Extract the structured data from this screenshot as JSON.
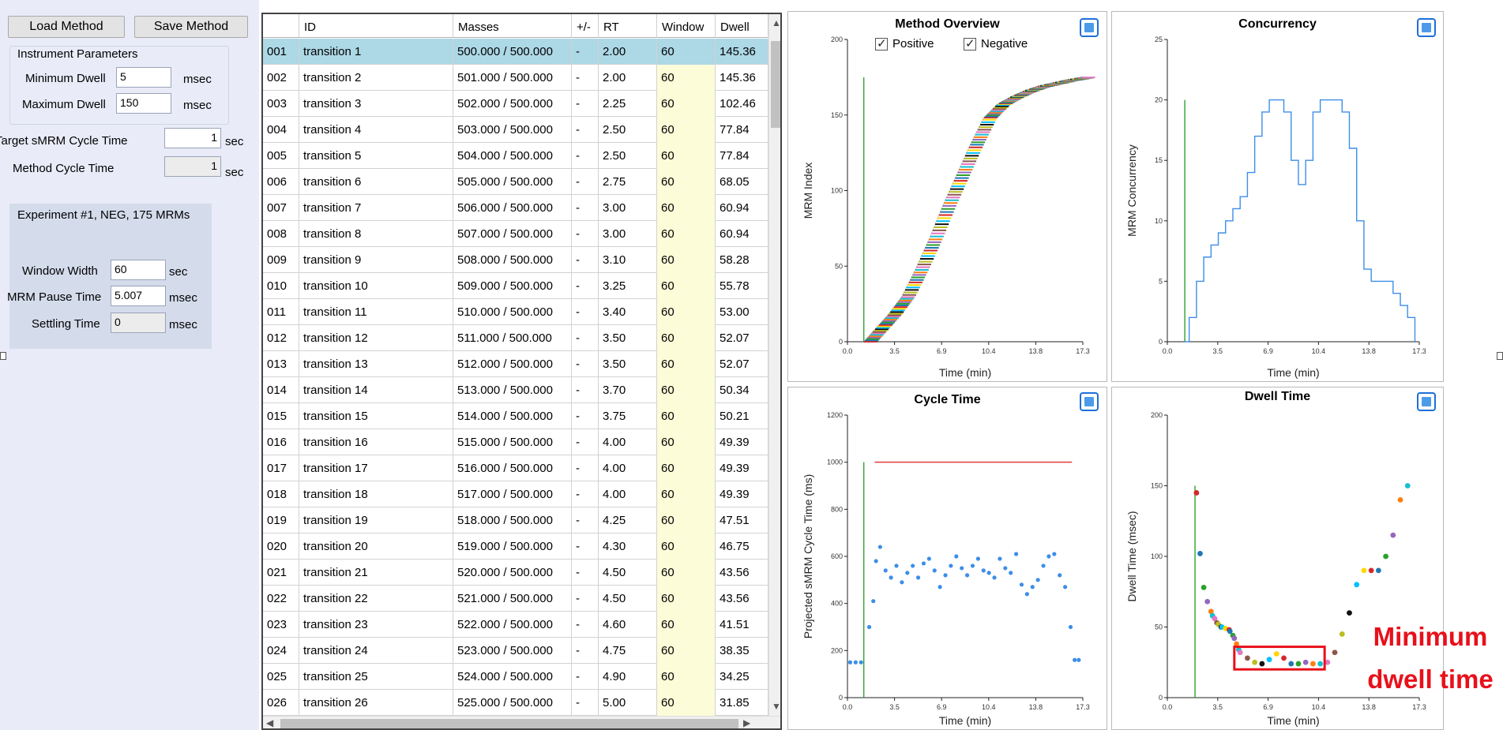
{
  "left_panel": {
    "load_button": "Load Method",
    "save_button": "Save Method",
    "instrument_params_title": "Instrument Parameters",
    "min_dwell_label": "Minimum Dwell",
    "min_dwell_value": "5",
    "min_dwell_unit": "msec",
    "max_dwell_label": "Maximum Dwell",
    "max_dwell_value": "150",
    "max_dwell_unit": "msec",
    "target_cycle_label": "Target sMRM Cycle Time",
    "target_cycle_value": "1",
    "target_cycle_unit": "sec",
    "method_cycle_label": "Method Cycle Time",
    "method_cycle_value": "1",
    "method_cycle_unit": "sec",
    "experiment_title": "Experiment #1, NEG, 175 MRMs",
    "window_width_label": "Window Width",
    "window_width_value": "60",
    "window_width_unit": "sec",
    "pause_label": "MRM Pause Time",
    "pause_value": "5.007",
    "pause_unit": "msec",
    "settling_label": "Settling Time",
    "settling_value": "0",
    "settling_unit": "msec"
  },
  "table": {
    "columns": [
      "ID",
      "Masses",
      "+/-",
      "RT",
      "Window",
      "Dwell"
    ],
    "rows": [
      {
        "num": "001",
        "id": "transition 1",
        "masses": "500.000 / 500.000",
        "pm": "-",
        "rt": "2.00",
        "window": "60",
        "dwell": "145.36"
      },
      {
        "num": "002",
        "id": "transition 2",
        "masses": "501.000 / 500.000",
        "pm": "-",
        "rt": "2.00",
        "window": "60",
        "dwell": "145.36"
      },
      {
        "num": "003",
        "id": "transition 3",
        "masses": "502.000 / 500.000",
        "pm": "-",
        "rt": "2.25",
        "window": "60",
        "dwell": "102.46"
      },
      {
        "num": "004",
        "id": "transition 4",
        "masses": "503.000 / 500.000",
        "pm": "-",
        "rt": "2.50",
        "window": "60",
        "dwell": "77.84"
      },
      {
        "num": "005",
        "id": "transition 5",
        "masses": "504.000 / 500.000",
        "pm": "-",
        "rt": "2.50",
        "window": "60",
        "dwell": "77.84"
      },
      {
        "num": "006",
        "id": "transition 6",
        "masses": "505.000 / 500.000",
        "pm": "-",
        "rt": "2.75",
        "window": "60",
        "dwell": "68.05"
      },
      {
        "num": "007",
        "id": "transition 7",
        "masses": "506.000 / 500.000",
        "pm": "-",
        "rt": "3.00",
        "window": "60",
        "dwell": "60.94"
      },
      {
        "num": "008",
        "id": "transition 8",
        "masses": "507.000 / 500.000",
        "pm": "-",
        "rt": "3.00",
        "window": "60",
        "dwell": "60.94"
      },
      {
        "num": "009",
        "id": "transition 9",
        "masses": "508.000 / 500.000",
        "pm": "-",
        "rt": "3.10",
        "window": "60",
        "dwell": "58.28"
      },
      {
        "num": "010",
        "id": "transition 10",
        "masses": "509.000 / 500.000",
        "pm": "-",
        "rt": "3.25",
        "window": "60",
        "dwell": "55.78"
      },
      {
        "num": "011",
        "id": "transition 11",
        "masses": "510.000 / 500.000",
        "pm": "-",
        "rt": "3.40",
        "window": "60",
        "dwell": "53.00"
      },
      {
        "num": "012",
        "id": "transition 12",
        "masses": "511.000 / 500.000",
        "pm": "-",
        "rt": "3.50",
        "window": "60",
        "dwell": "52.07"
      },
      {
        "num": "013",
        "id": "transition 13",
        "masses": "512.000 / 500.000",
        "pm": "-",
        "rt": "3.50",
        "window": "60",
        "dwell": "52.07"
      },
      {
        "num": "014",
        "id": "transition 14",
        "masses": "513.000 / 500.000",
        "pm": "-",
        "rt": "3.70",
        "window": "60",
        "dwell": "50.34"
      },
      {
        "num": "015",
        "id": "transition 15",
        "masses": "514.000 / 500.000",
        "pm": "-",
        "rt": "3.75",
        "window": "60",
        "dwell": "50.21"
      },
      {
        "num": "016",
        "id": "transition 16",
        "masses": "515.000 / 500.000",
        "pm": "-",
        "rt": "4.00",
        "window": "60",
        "dwell": "49.39"
      },
      {
        "num": "017",
        "id": "transition 17",
        "masses": "516.000 / 500.000",
        "pm": "-",
        "rt": "4.00",
        "window": "60",
        "dwell": "49.39"
      },
      {
        "num": "018",
        "id": "transition 18",
        "masses": "517.000 / 500.000",
        "pm": "-",
        "rt": "4.00",
        "window": "60",
        "dwell": "49.39"
      },
      {
        "num": "019",
        "id": "transition 19",
        "masses": "518.000 / 500.000",
        "pm": "-",
        "rt": "4.25",
        "window": "60",
        "dwell": "47.51"
      },
      {
        "num": "020",
        "id": "transition 20",
        "masses": "519.000 / 500.000",
        "pm": "-",
        "rt": "4.30",
        "window": "60",
        "dwell": "46.75"
      },
      {
        "num": "021",
        "id": "transition 21",
        "masses": "520.000 / 500.000",
        "pm": "-",
        "rt": "4.50",
        "window": "60",
        "dwell": "43.56"
      },
      {
        "num": "022",
        "id": "transition 22",
        "masses": "521.000 / 500.000",
        "pm": "-",
        "rt": "4.50",
        "window": "60",
        "dwell": "43.56"
      },
      {
        "num": "023",
        "id": "transition 23",
        "masses": "522.000 / 500.000",
        "pm": "-",
        "rt": "4.60",
        "window": "60",
        "dwell": "41.51"
      },
      {
        "num": "024",
        "id": "transition 24",
        "masses": "523.000 / 500.000",
        "pm": "-",
        "rt": "4.75",
        "window": "60",
        "dwell": "38.35"
      },
      {
        "num": "025",
        "id": "transition 25",
        "masses": "524.000 / 500.000",
        "pm": "-",
        "rt": "4.90",
        "window": "60",
        "dwell": "34.25"
      },
      {
        "num": "026",
        "id": "transition 26",
        "masses": "525.000 / 500.000",
        "pm": "-",
        "rt": "5.00",
        "window": "60",
        "dwell": "31.85"
      }
    ]
  },
  "checkboxes": {
    "positive": "Positive",
    "negative": "Negative"
  },
  "annotation": {
    "line1": "Minimum",
    "line2": "dwell time"
  },
  "colors": {
    "accent": "#1e6fd9",
    "series_blue": "#3d8ee8",
    "limit_red": "#e23b3b",
    "rt_marker": "#3ca63c",
    "annotation_red": "#e8101a"
  },
  "chart_data": [
    {
      "type": "line",
      "title": "Method Overview",
      "xlabel": "Time (min)",
      "ylabel": "MRM Index",
      "xticks": [
        "0.0",
        "3.5",
        "6.9",
        "10.4",
        "13.8",
        "17.3"
      ],
      "yticks": [
        "0",
        "50",
        "100",
        "150",
        "200"
      ],
      "xlim": [
        0,
        17.3
      ],
      "ylim": [
        0,
        200
      ],
      "series": [
        {
          "values_x": [
            1.2,
            2,
            3,
            4,
            5,
            6,
            7,
            8,
            9,
            10,
            11,
            12,
            13,
            14,
            15,
            16,
            17.3
          ],
          "values_y": [
            0,
            8,
            18,
            30,
            48,
            68,
            90,
            110,
            130,
            148,
            157,
            162,
            166,
            169,
            171,
            173,
            175
          ]
        }
      ],
      "rt_marker_x": 1.2,
      "rt_marker_top": 175
    },
    {
      "type": "line",
      "title": "Concurrency",
      "xlabel": "Time (min)",
      "ylabel": "MRM Concurrency",
      "xticks": [
        "0.0",
        "3.5",
        "6.9",
        "10.4",
        "13.8",
        "17.3"
      ],
      "yticks": [
        "0",
        "5",
        "10",
        "15",
        "20",
        "25"
      ],
      "xlim": [
        0,
        17.3
      ],
      "ylim": [
        0,
        25
      ],
      "series": [
        {
          "values_x": [
            1.2,
            1.5,
            2,
            2.5,
            3,
            3.5,
            4,
            4.5,
            5,
            5.5,
            6,
            6.5,
            7,
            7.5,
            8,
            8.5,
            9,
            9.5,
            10,
            10.5,
            11,
            11.5,
            12,
            12.5,
            13,
            13.5,
            14,
            14.5,
            15,
            15.5,
            16,
            16.5,
            17
          ],
          "values_y": [
            0,
            2,
            5,
            7,
            8,
            9,
            10,
            11,
            12,
            14,
            17,
            19,
            20,
            20,
            19,
            15,
            13,
            15,
            19,
            20,
            20,
            20,
            19,
            16,
            10,
            6,
            5,
            5,
            5,
            4,
            3,
            2,
            0
          ]
        }
      ],
      "rt_marker_x": 1.2,
      "rt_marker_top": 20
    },
    {
      "type": "scatter",
      "title": "Cycle Time",
      "xlabel": "Time (min)",
      "ylabel": "Projected sMRM Cycle Time (ms)",
      "xticks": [
        "0.0",
        "3.5",
        "6.9",
        "10.4",
        "13.8",
        "17.3"
      ],
      "yticks": [
        "0",
        "200",
        "400",
        "600",
        "800",
        "1000",
        "1200"
      ],
      "xlim": [
        0,
        17.3
      ],
      "ylim": [
        0,
        1200
      ],
      "target_line": {
        "y": 1000,
        "x_from": 2,
        "x_to": 16.5
      },
      "series": [
        {
          "values_x": [
            0.2,
            0.6,
            1,
            1.6,
            1.9,
            2.1,
            2.4,
            2.8,
            3.2,
            3.6,
            4,
            4.4,
            4.8,
            5.2,
            5.6,
            6,
            6.4,
            6.8,
            7.2,
            7.6,
            8,
            8.4,
            8.8,
            9.2,
            9.6,
            10,
            10.4,
            10.8,
            11.2,
            11.6,
            12,
            12.4,
            12.8,
            13.2,
            13.6,
            14,
            14.4,
            14.8,
            15.2,
            15.6,
            16,
            16.4,
            16.7,
            17
          ],
          "values_y": [
            150,
            150,
            150,
            300,
            410,
            580,
            640,
            540,
            510,
            560,
            490,
            530,
            560,
            510,
            570,
            590,
            540,
            470,
            520,
            560,
            600,
            550,
            520,
            560,
            590,
            540,
            530,
            510,
            590,
            550,
            530,
            610,
            480,
            440,
            470,
            500,
            560,
            600,
            610,
            520,
            470,
            300,
            160,
            160
          ]
        }
      ],
      "rt_marker_x": 1.2,
      "rt_marker_top": 1000
    },
    {
      "type": "scatter",
      "title": "Dwell Time",
      "xlabel": "Time (min)",
      "ylabel": "Dwell Time (msec)",
      "xticks": [
        "0.0",
        "3.5",
        "6.9",
        "10.4",
        "13.8",
        "17.3"
      ],
      "yticks": [
        "0",
        "50",
        "100",
        "150",
        "200"
      ],
      "xlim": [
        0,
        17.3
      ],
      "ylim": [
        0,
        200
      ],
      "series": [
        {
          "values_x": [
            2,
            2.25,
            2.5,
            2.75,
            3,
            3.1,
            3.25,
            3.4,
            3.5,
            3.7,
            3.75,
            4,
            4.25,
            4.3,
            4.5,
            4.6,
            4.75,
            4.9,
            5,
            5.5,
            6,
            6.5,
            7,
            7.5,
            8,
            8.5,
            9,
            9.5,
            10,
            10.5,
            11,
            11.5,
            12,
            12.5,
            13,
            13.5,
            14,
            14.5,
            15,
            15.5,
            16,
            16.5
          ],
          "values_y": [
            145,
            102,
            78,
            68,
            61,
            58,
            56,
            53,
            52,
            50,
            50,
            49,
            48,
            47,
            44,
            42,
            38,
            34,
            32,
            28,
            25,
            24,
            27,
            31,
            28,
            24,
            24,
            25,
            24,
            24,
            25,
            32,
            45,
            60,
            80,
            90,
            90,
            90,
            100,
            115,
            140,
            150
          ]
        }
      ],
      "rt_marker_x": 1.9,
      "rt_marker_top": 150,
      "highlight_box": {
        "x_from": 4.6,
        "x_to": 10.8,
        "y_from": 20,
        "y_to": 36
      }
    }
  ]
}
